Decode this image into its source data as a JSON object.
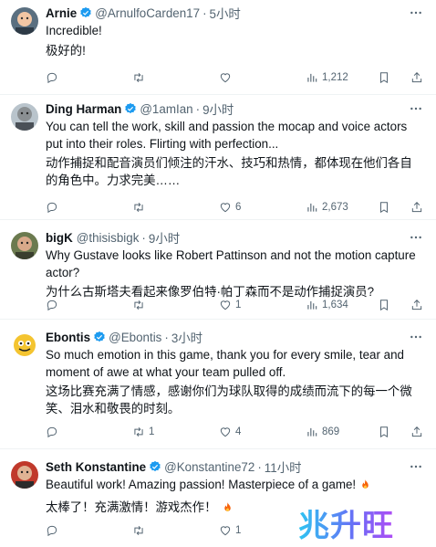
{
  "tweets": [
    {
      "name": "Arnie",
      "handle": "@ArnulfoCarden17",
      "time": "5小时",
      "lines": [
        "Incredible!",
        "极好的!"
      ],
      "reply_count": "",
      "retweet_count": "",
      "like_count": "",
      "view_count": "1,212",
      "avatar_icon": "avatar-baby-icon"
    },
    {
      "name": "Ding Harman",
      "handle": "@1amIan",
      "time": "9小时",
      "lines": [
        "You can tell the work, skill and passion the mocap and voice actors put into their roles. Flirting with perfection...",
        "动作捕捉和配音演员们倾注的汗水、技巧和热情，都体现在他们各自的角色中。力求完美……"
      ],
      "reply_count": "",
      "retweet_count": "",
      "like_count": "6",
      "view_count": "2,673",
      "avatar_icon": "avatar-man-icon"
    },
    {
      "name": "bigK",
      "handle": "@thisisbigk",
      "time": "9小时",
      "lines": [
        "Why Gustave looks like Robert Pattinson and not the motion capture actor?",
        "为什么古斯塔夫看起来像罗伯特·帕丁森而不是动作捕捉演员?"
      ],
      "reply_count": "",
      "retweet_count": "",
      "like_count": "1",
      "view_count": "1,634",
      "avatar_icon": "avatar-man-icon"
    },
    {
      "name": "Ebontis",
      "handle": "@Ebontis",
      "time": "3小时",
      "lines": [
        "So much emotion in this game, thank you for every smile, tear and moment of awe at what your team pulled off.",
        "这场比赛充满了情感，感谢你们为球队取得的成绩而流下的每一个微笑、泪水和敬畏的时刻。"
      ],
      "reply_count": "",
      "retweet_count": "1",
      "like_count": "4",
      "view_count": "869",
      "avatar_icon": "avatar-cartoon-icon"
    },
    {
      "name": "Seth Konstantine",
      "handle": "@Konstantine72",
      "time": "11小时",
      "lines": [
        "Beautiful work! Amazing passion! Masterpiece of a game!",
        "太棒了！充满激情！游戏杰作！"
      ],
      "reply_count": "",
      "retweet_count": "",
      "like_count": "1",
      "view_count": "",
      "avatar_icon": "avatar-man-icon"
    }
  ],
  "watermark": "兆升旺",
  "colors": {
    "verified": "#1d9bf0",
    "muted": "#536471",
    "text": "#0f1419",
    "divider": "#eff3f4"
  }
}
